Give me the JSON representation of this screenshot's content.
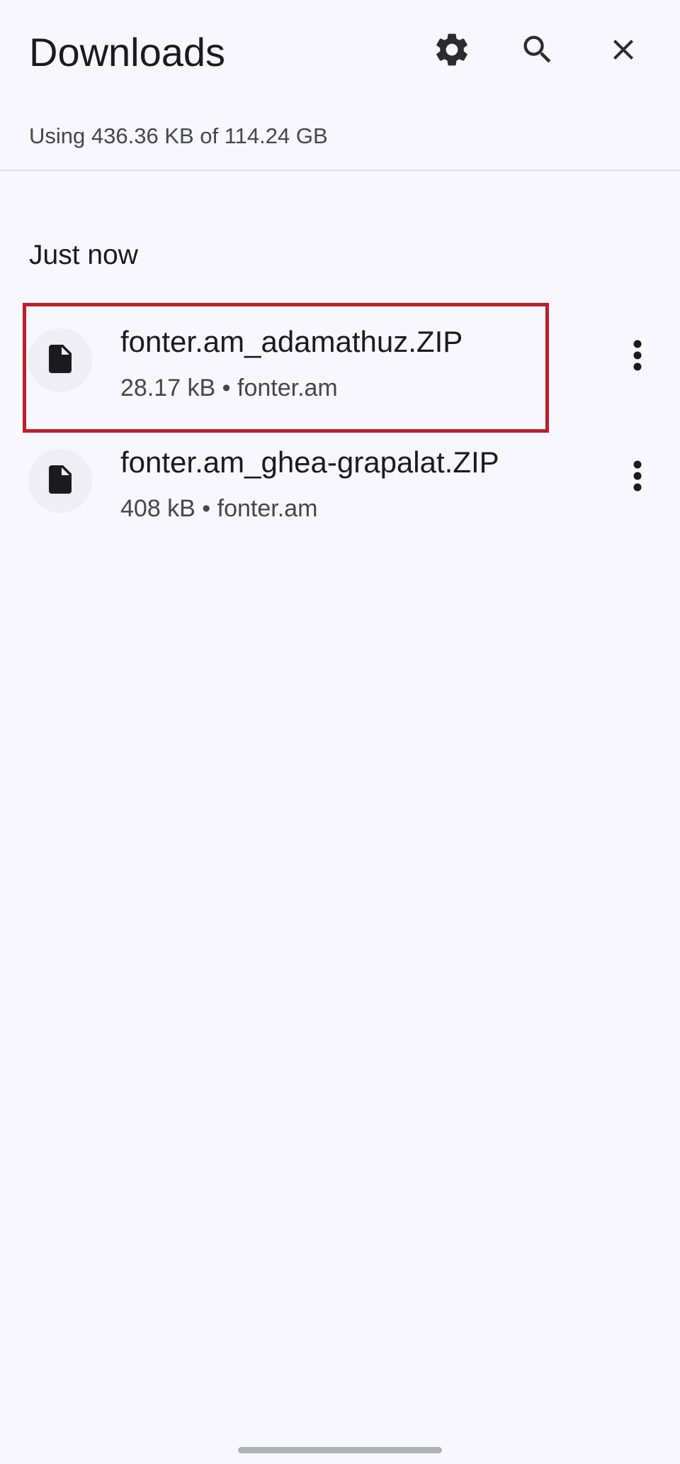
{
  "header": {
    "title": "Downloads",
    "icons": {
      "settings": "gear-icon",
      "search": "search-icon",
      "close": "close-icon"
    }
  },
  "storage": {
    "text": "Using 436.36 KB of 114.24 GB"
  },
  "section": {
    "heading": "Just now"
  },
  "downloads": [
    {
      "name": "fonter.am_adamathuz.ZIP",
      "meta": "28.17 kB • fonter.am",
      "icon": "file-icon",
      "highlighted": true
    },
    {
      "name": "fonter.am_ghea-grapalat.ZIP",
      "meta": "408 kB • fonter.am",
      "icon": "file-icon",
      "highlighted": false
    }
  ],
  "colors": {
    "background": "#f8f7fd",
    "text_primary": "#1b1b1f",
    "text_secondary": "#46464f",
    "highlight": "#be1e2d",
    "icon_dark": "#1b1b1f"
  }
}
